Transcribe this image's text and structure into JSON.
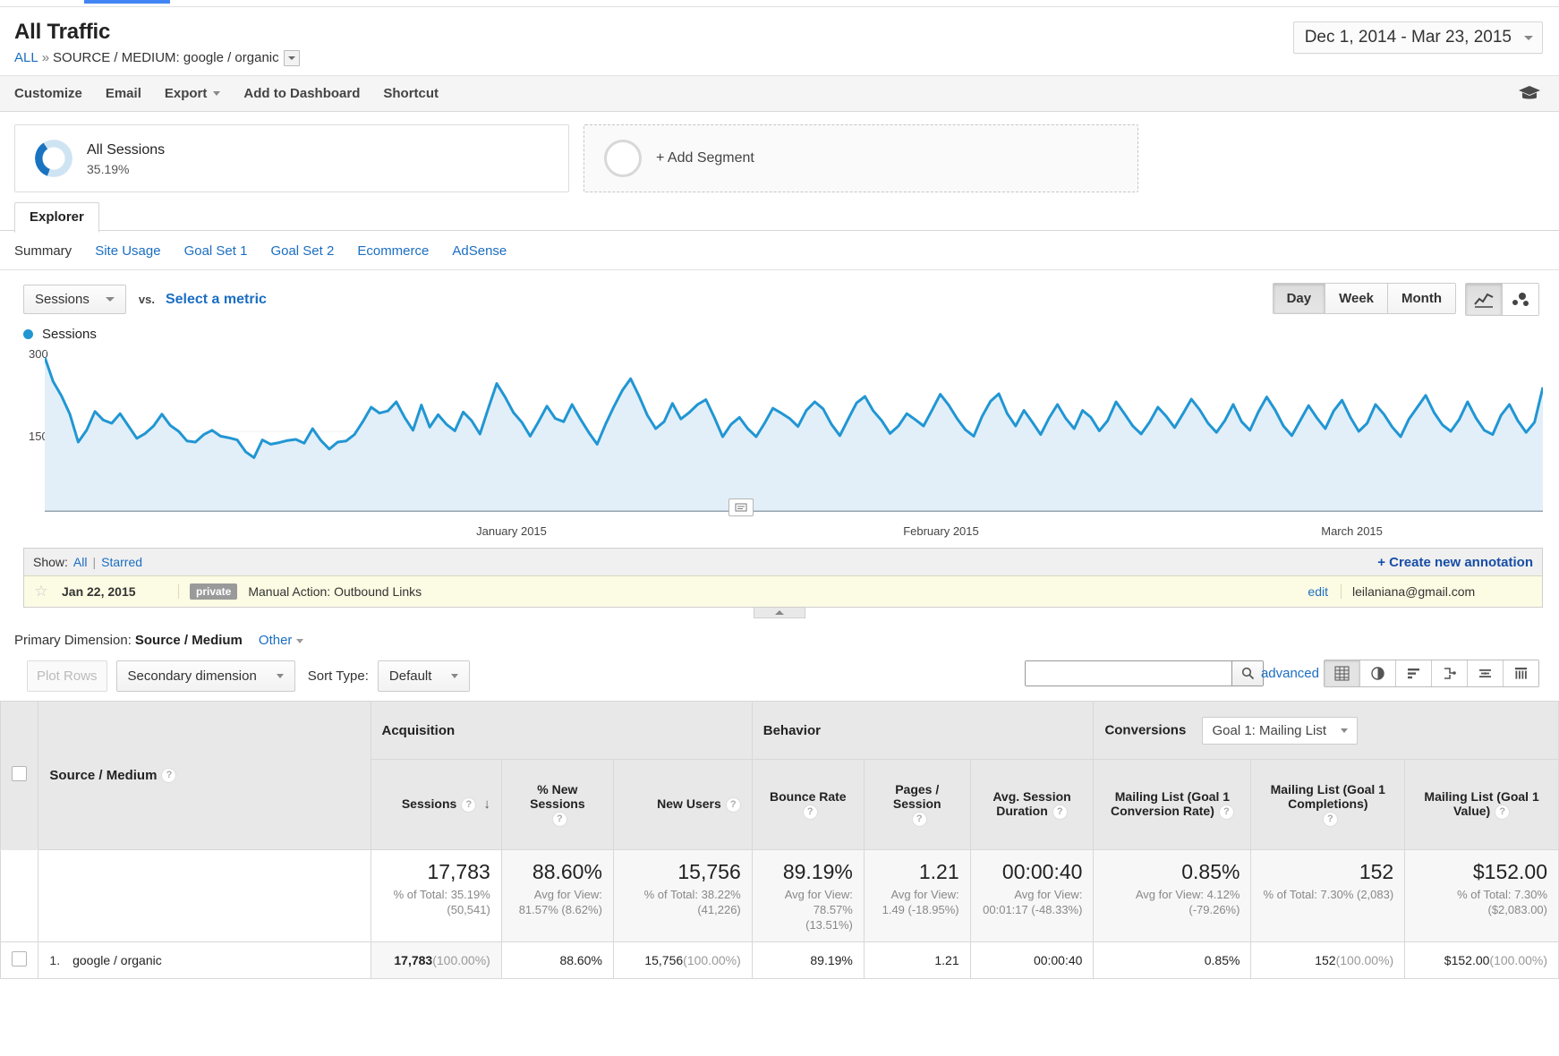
{
  "header": {
    "title": "All Traffic",
    "breadcrumb_all": "ALL",
    "breadcrumb_sep": "»",
    "breadcrumb_current": "SOURCE / MEDIUM: google / organic",
    "date_range": "Dec 1, 2014 - Mar 23, 2015"
  },
  "actionbar": {
    "items": [
      "Customize",
      "Email",
      "Export",
      "Add to Dashboard",
      "Shortcut"
    ]
  },
  "segments": {
    "all_sessions_name": "All Sessions",
    "all_sessions_pct": "35.19%",
    "add_segment_label": "+ Add Segment"
  },
  "explorer": {
    "tab_label": "Explorer",
    "subtabs": [
      "Summary",
      "Site Usage",
      "Goal Set 1",
      "Goal Set 2",
      "Ecommerce",
      "AdSense"
    ],
    "active_subtab": "Summary"
  },
  "metricbar": {
    "metric": "Sessions",
    "vs": "vs.",
    "select_metric": "Select a metric",
    "granularity": [
      "Day",
      "Week",
      "Month"
    ],
    "granularity_selected": "Day"
  },
  "legend": {
    "series_name": "Sessions"
  },
  "annotations": {
    "show_label": "Show:",
    "all": "All",
    "pipe": "|",
    "starred": "Starred",
    "create": "+ Create new annotation",
    "rows": [
      {
        "date": "Jan 22, 2015",
        "visibility": "private",
        "text": "Manual Action: Outbound Links",
        "edit": "edit",
        "user": "leilaniana@gmail.com"
      }
    ]
  },
  "table_controls": {
    "primary_dimension_label": "Primary Dimension:",
    "primary_dimension_value": "Source / Medium",
    "other": "Other",
    "plot_rows": "Plot Rows",
    "secondary_dimension": "Secondary dimension",
    "sort_type_label": "Sort Type:",
    "sort_type_value": "Default",
    "search_value": "",
    "search_placeholder": "",
    "advanced": "advanced"
  },
  "table": {
    "dimension_header": "Source / Medium",
    "groups": [
      {
        "label": "Acquisition",
        "span": 3
      },
      {
        "label": "Behavior",
        "span": 3
      },
      {
        "label": "Conversions",
        "span": 3,
        "goal_select": "Goal 1: Mailing List"
      }
    ],
    "columns": [
      "Sessions",
      "% New Sessions",
      "New Users",
      "Bounce Rate",
      "Pages / Session",
      "Avg. Session Duration",
      "Mailing List (Goal 1 Conversion Rate)",
      "Mailing List (Goal 1 Completions)",
      "Mailing List (Goal 1 Value)"
    ],
    "sorted_column": "Sessions",
    "summary": [
      {
        "big": "17,783",
        "sub": "% of Total: 35.19% (50,541)"
      },
      {
        "big": "88.60%",
        "sub": "Avg for View: 81.57% (8.62%)"
      },
      {
        "big": "15,756",
        "sub": "% of Total: 38.22% (41,226)"
      },
      {
        "big": "89.19%",
        "sub": "Avg for View: 78.57% (13.51%)"
      },
      {
        "big": "1.21",
        "sub": "Avg for View: 1.49 (-18.95%)"
      },
      {
        "big": "00:00:40",
        "sub": "Avg for View: 00:01:17 (-48.33%)"
      },
      {
        "big": "0.85%",
        "sub": "Avg for View: 4.12% (-79.26%)"
      },
      {
        "big": "152",
        "sub": "% of Total: 7.30% (2,083)"
      },
      {
        "big": "$152.00",
        "sub": "% of Total: 7.30% ($2,083.00)"
      }
    ],
    "rows": [
      {
        "index": "1.",
        "label": "google / organic",
        "cells": [
          {
            "value": "17,783",
            "pct": "(100.00%)"
          },
          {
            "value": "88.60%",
            "pct": ""
          },
          {
            "value": "15,756",
            "pct": "(100.00%)"
          },
          {
            "value": "89.19%",
            "pct": ""
          },
          {
            "value": "1.21",
            "pct": ""
          },
          {
            "value": "00:00:40",
            "pct": ""
          },
          {
            "value": "0.85%",
            "pct": ""
          },
          {
            "value": "152",
            "pct": "(100.00%)"
          },
          {
            "value": "$152.00",
            "pct": "(100.00%)"
          }
        ]
      }
    ]
  },
  "chart_data": {
    "type": "line",
    "title": "",
    "series_name": "Sessions",
    "ylabel": "",
    "xlabel": "",
    "ylim": [
      0,
      300
    ],
    "yticks": [
      150,
      300
    ],
    "grid": true,
    "legend_position": "top-left",
    "xtick_labels": [
      "January 2015",
      "February 2015",
      "March 2015"
    ],
    "xtick_positions_pct": [
      28.8,
      57.3,
      85.2
    ],
    "accent_color": "#2196d3",
    "fill_color": "#e2eff8",
    "values": [
      288,
      243,
      216,
      182,
      130,
      152,
      187,
      171,
      165,
      183,
      160,
      137,
      146,
      160,
      182,
      161,
      150,
      132,
      130,
      144,
      152,
      141,
      138,
      134,
      112,
      101,
      134,
      126,
      129,
      133,
      135,
      128,
      155,
      133,
      117,
      130,
      132,
      144,
      168,
      195,
      184,
      188,
      205,
      176,
      152,
      199,
      158,
      181,
      163,
      151,
      186,
      170,
      145,
      193,
      239,
      214,
      185,
      167,
      141,
      168,
      197,
      174,
      168,
      200,
      173,
      148,
      126,
      163,
      196,
      226,
      248,
      216,
      180,
      155,
      168,
      202,
      173,
      185,
      200,
      209,
      176,
      140,
      163,
      176,
      155,
      140,
      165,
      193,
      184,
      174,
      159,
      189,
      205,
      192,
      163,
      142,
      173,
      203,
      215,
      188,
      170,
      146,
      160,
      183,
      172,
      160,
      189,
      219,
      199,
      174,
      153,
      141,
      178,
      206,
      220,
      183,
      160,
      189,
      167,
      144,
      175,
      200,
      174,
      155,
      189,
      176,
      151,
      170,
      205,
      183,
      160,
      145,
      167,
      195,
      178,
      157,
      183,
      210,
      190,
      165,
      148,
      170,
      200,
      168,
      152,
      186,
      214,
      190,
      160,
      142,
      170,
      198,
      175,
      155,
      188,
      208,
      176,
      150,
      165,
      200,
      182,
      158,
      140,
      173,
      195,
      217,
      185,
      162,
      150,
      172,
      205,
      175,
      152,
      144,
      180,
      200,
      170,
      148,
      167,
      232
    ]
  }
}
